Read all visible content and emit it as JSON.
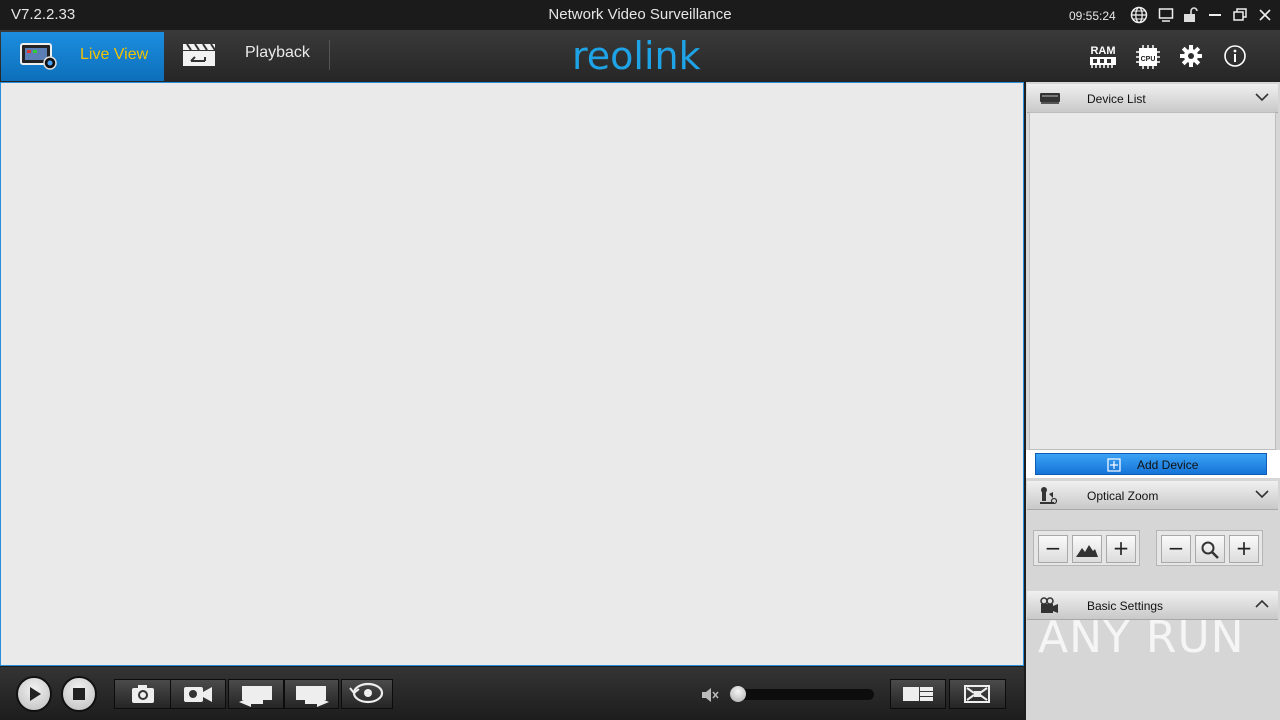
{
  "titlebar": {
    "version": "V7.2.2.33",
    "title": "Network Video Surveillance",
    "clock": "09:55:24",
    "icons": [
      "globe-icon",
      "monitor-icon",
      "lock-icon",
      "minimize-icon",
      "restore-icon",
      "close-icon"
    ]
  },
  "nav": {
    "live_view_label": "Live View",
    "playback_label": "Playback",
    "logo_text": "reolink",
    "right_icons": [
      "ram-icon",
      "cpu-icon",
      "settings-gear-icon",
      "info-icon"
    ],
    "ram_label": "RAM",
    "cpu_label": "CPU",
    "accent_color": "#1e90e0",
    "active_label_color": "#f2c200"
  },
  "panel": {
    "device_list_title": "Device List",
    "add_device_label": "Add Device",
    "optical_zoom_title": "Optical Zoom",
    "basic_settings_title": "Basic Settings",
    "zoom_minus": "−",
    "zoom_plus": "+"
  },
  "watermark": "ANY RUN",
  "controls": {
    "buttons": [
      "play-icon",
      "stop-icon",
      "snapshot-icon",
      "record-icon",
      "previous-icon",
      "next-icon",
      "loop-icon",
      "mute-icon",
      "layout-icon",
      "fullscreen-icon"
    ],
    "volume_level": 0
  }
}
